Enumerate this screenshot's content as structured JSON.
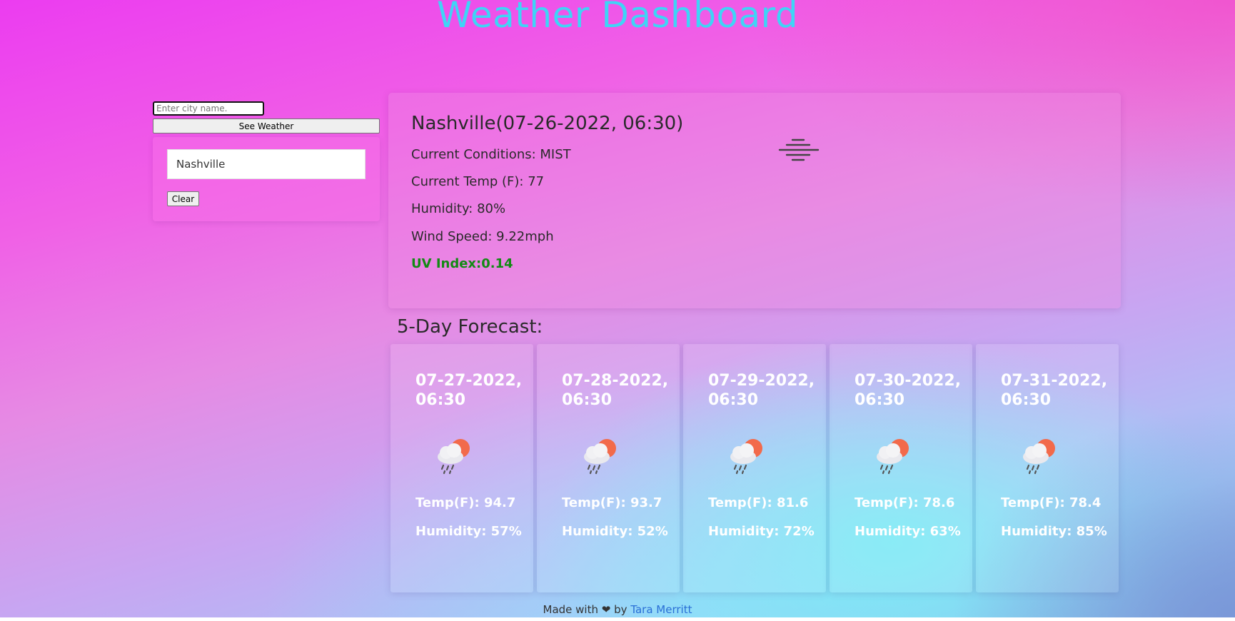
{
  "header": {
    "title": "Weather Dashboard"
  },
  "search": {
    "placeholder": "Enter city name.",
    "value": "",
    "button_label": "See Weather"
  },
  "history": {
    "items": [
      {
        "label": "Nashville"
      }
    ],
    "clear_label": "Clear"
  },
  "current": {
    "title": "Nashville(07-26-2022, 06:30)",
    "conditions": "Current Conditions: MIST",
    "temp": "Current Temp (F): 77",
    "humidity": "Humidity: 80%",
    "wind": "Wind Speed: 9.22mph",
    "uv": "UV Index:0.14",
    "icon": "mist-icon",
    "uv_color": "#128a14"
  },
  "forecast": {
    "title": "5-Day Forecast:",
    "days": [
      {
        "date": "07-27-2022, 06:30",
        "icon": "rain-cloud-sun-icon",
        "temp": "Temp(F): 94.7",
        "humidity": "Humidity: 57%"
      },
      {
        "date": "07-28-2022, 06:30",
        "icon": "rain-cloud-sun-icon",
        "temp": "Temp(F): 93.7",
        "humidity": "Humidity: 52%"
      },
      {
        "date": "07-29-2022, 06:30",
        "icon": "rain-cloud-sun-icon",
        "temp": "Temp(F): 81.6",
        "humidity": "Humidity: 72%"
      },
      {
        "date": "07-30-2022, 06:30",
        "icon": "rain-cloud-sun-icon",
        "temp": "Temp(F): 78.6",
        "humidity": "Humidity: 63%"
      },
      {
        "date": "07-31-2022, 06:30",
        "icon": "rain-cloud-sun-icon",
        "temp": "Temp(F): 78.4",
        "humidity": "Humidity: 85%"
      }
    ]
  },
  "footer": {
    "prefix": "Made with",
    "heart_icon": "heart-icon",
    "by": "by",
    "author": "Tara Merritt"
  },
  "colors": {
    "title": "#3fd4f6",
    "link": "#2a6fd6"
  }
}
